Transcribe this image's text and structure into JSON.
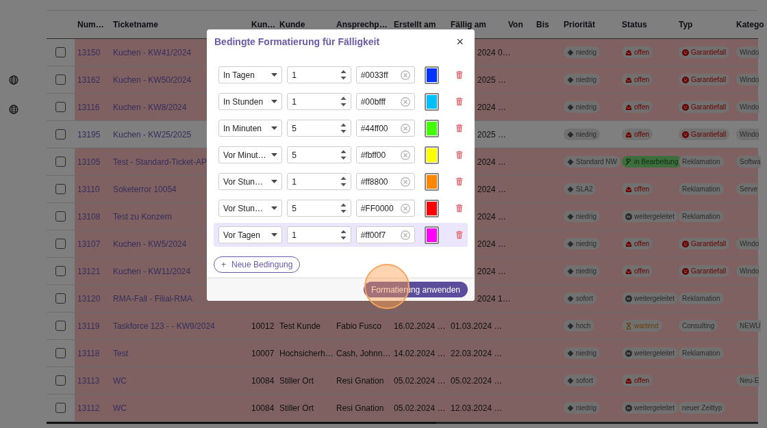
{
  "table": {
    "columns": [
      "Num…",
      "Ticketname",
      "Kun…",
      "Kunde",
      "Ansprechp…",
      "Erstellt am",
      "Fällig am",
      "Von",
      "Bis",
      "Priorität",
      "Status",
      "Typ",
      "Katego"
    ],
    "rows": [
      {
        "number": "13150",
        "name": "Kuchen - KW41/2024",
        "due": "2024 0…",
        "priority": "niedrig",
        "status": {
          "label": "offen",
          "kind": "open"
        },
        "type": {
          "label": "Garantiefall",
          "kind": "warranty"
        },
        "category": "Windo",
        "highlighted": true
      },
      {
        "number": "13162",
        "name": "Kuchen - KW50/2024",
        "due": "2025 …",
        "priority": "niedrig",
        "status": {
          "label": "offen",
          "kind": "open"
        },
        "type": {
          "label": "Garantiefall",
          "kind": "warranty"
        },
        "category": "Windo",
        "highlighted": true
      },
      {
        "number": "13116",
        "name": "Kuchen - KW8/2024",
        "due": "2024 …",
        "priority": "niedrig",
        "status": {
          "label": "offen",
          "kind": "open"
        },
        "type": {
          "label": "Garantiefall",
          "kind": "warranty"
        },
        "category": "Windo",
        "highlighted": true
      },
      {
        "number": "13195",
        "name": "Kuchen - KW25/2025",
        "due": "2025 …",
        "priority": "niedrig",
        "status": {
          "label": "offen",
          "kind": "open"
        },
        "type": {
          "label": "Garantiefall",
          "kind": "warranty"
        },
        "category": "Windo",
        "highlighted": false
      },
      {
        "number": "13105",
        "name": "Test - Standard-Ticket-AP",
        "due": "2024 …",
        "priority": "Standard NW",
        "status": {
          "label": "in Bearbeitung",
          "kind": "in_progress"
        },
        "type": {
          "label": "Reklamation",
          "kind": "plain"
        },
        "category": "Softwa",
        "highlighted": true
      },
      {
        "number": "13110",
        "name": "Soketerror 10054",
        "due": "2024 …",
        "priority": "SLA2",
        "status": {
          "label": "offen",
          "kind": "open"
        },
        "type": {
          "label": "Reklamation",
          "kind": "plain"
        },
        "category": "Serve",
        "highlighted": true
      },
      {
        "number": "13108",
        "name": "Test zu Konzern",
        "due": "2024 …",
        "priority": "niedrig",
        "status": {
          "label": "weitergeleitet",
          "kind": "forwarded"
        },
        "type": {
          "label": "Reklamation",
          "kind": "plain"
        },
        "highlighted": true
      },
      {
        "number": "13107",
        "name": "Kuchen - KW5/2024",
        "due": "2024 …",
        "priority": "niedrig",
        "status": {
          "label": "offen",
          "kind": "open"
        },
        "type": {
          "label": "Garantiefall",
          "kind": "warranty"
        },
        "category": "Windo",
        "highlighted": true
      },
      {
        "number": "13121",
        "name": "Kuchen - KW11/2024",
        "due": "2024 …",
        "priority": "niedrig",
        "status": {
          "label": "offen",
          "kind": "open"
        },
        "type": {
          "label": "Garantiefall",
          "kind": "warranty"
        },
        "category": "Windo",
        "highlighted": true
      },
      {
        "number": "13120",
        "name": "RMA-Fall - Filial-RMA",
        "due": "2024 1…",
        "priority": "sofort",
        "status": {
          "label": "weitergeleitet",
          "kind": "forwarded"
        },
        "type": {
          "label": "Reklamation",
          "kind": "plain"
        },
        "highlighted": true
      },
      {
        "number": "13119",
        "name": "Taskforce 123 - - KW9/2024",
        "customer_no": "10012",
        "customer": "Test Kunde",
        "contact": "Fabio Fusco",
        "created": "16.02.2024 …",
        "due": "01.03.2024 …",
        "priority": "hoch",
        "status": {
          "label": "wartend",
          "kind": "waiting"
        },
        "type": {
          "label": "Consulting",
          "kind": "plain"
        },
        "category": "NEWU",
        "highlighted": true
      },
      {
        "number": "13118",
        "name": "Test",
        "customer_no": "10007",
        "customer": "Hochsicherh…",
        "contact": "Cash, Johnn…",
        "created": "14.02.2024 …",
        "due": "22.03.2024 …",
        "priority": "niedrig",
        "status": {
          "label": "weitergeleitet",
          "kind": "forwarded"
        },
        "type": {
          "label": "Reklamation",
          "kind": "plain"
        },
        "highlighted": true
      },
      {
        "number": "13113",
        "name": "WC",
        "customer_no": "10084",
        "customer": "Stiller Ort",
        "contact": "Resi Gnation",
        "created": "05.02.2024 …",
        "due": "05.02.2024 …",
        "priority": "sofort",
        "status": {
          "label": "offen",
          "kind": "open"
        },
        "category": "Neu-E",
        "highlighted": true
      },
      {
        "number": "13112",
        "name": "WC",
        "customer_no": "10084",
        "customer": "Stiller Ort",
        "contact": "Resi Gnation",
        "created": "05.02.2024 …",
        "due": "12.03.2024 …",
        "priority": "niedrig",
        "status": {
          "label": "weitergeleitet",
          "kind": "forwarded"
        },
        "type": {
          "label": "neuer Zeittyp",
          "kind": "plain"
        },
        "highlighted": true
      }
    ]
  },
  "dialog": {
    "title": "Bedingte Formatierung für Fälligkeit",
    "close": "×",
    "conditions": [
      {
        "unit": "In Tagen",
        "amount": "1",
        "color": "#0033ff",
        "selected": false
      },
      {
        "unit": "In Stunden",
        "amount": "1",
        "color": "#00bfff",
        "selected": false
      },
      {
        "unit": "In Minuten",
        "amount": "5",
        "color": "#44ff00",
        "selected": false
      },
      {
        "unit": "Vor Minut…",
        "amount": "5",
        "color": "#fbff00",
        "selected": false
      },
      {
        "unit": "Vor Stun…",
        "amount": "1",
        "color": "#ff8800",
        "selected": false
      },
      {
        "unit": "Vor Stun…",
        "amount": "5",
        "color": "#FF0000",
        "selected": false
      },
      {
        "unit": "Vor Tagen",
        "amount": "1",
        "color": "#ff00f7",
        "selected": true
      }
    ],
    "add_button": "Neue Bedingung",
    "add_icon": "+",
    "apply_button": "Formatierung anwenden"
  }
}
